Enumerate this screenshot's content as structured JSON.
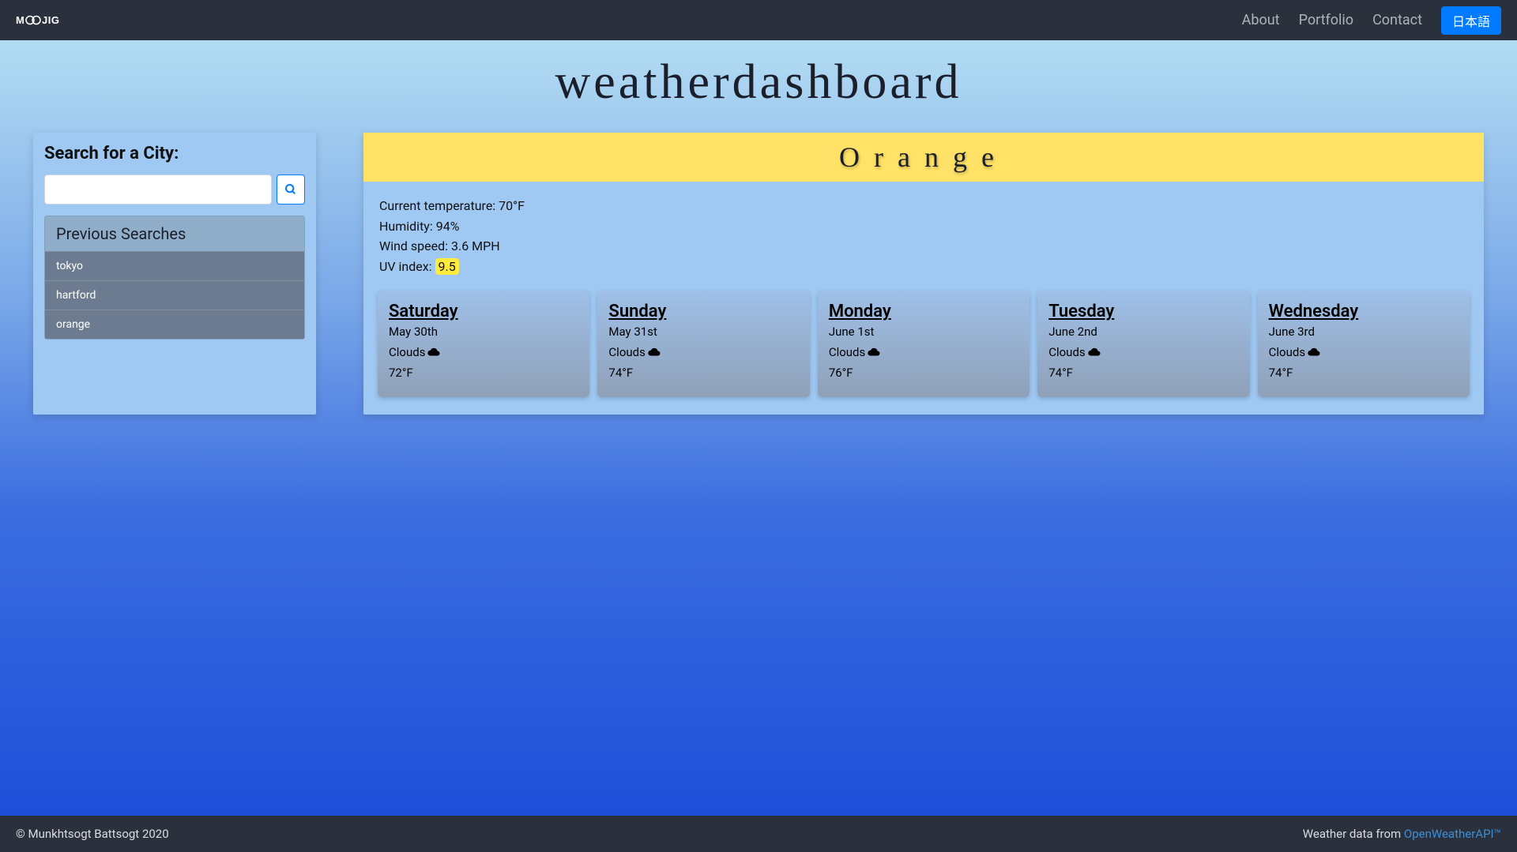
{
  "nav": {
    "links": [
      "About",
      "Portfolio",
      "Contact"
    ],
    "lang_btn": "日本語"
  },
  "hero": {
    "title": "weatherdashboard"
  },
  "sidebar": {
    "search_label": "Search for a City:",
    "search_placeholder": "",
    "previous_label": "Previous Searches",
    "history": [
      "tokyo",
      "hartford",
      "orange"
    ]
  },
  "weather": {
    "city": "Orange",
    "current": {
      "temp_label": "Current temperature: ",
      "temp_value": "70°F",
      "humidity_label": "Humidity: ",
      "humidity_value": "94%",
      "wind_label": "Wind speed: ",
      "wind_value": "3.6 MPH",
      "uv_label": "UV index: ",
      "uv_value": "9.5"
    },
    "forecast": [
      {
        "day": "Saturday",
        "date": "May 30th",
        "cond": "Clouds",
        "temp": "72°F"
      },
      {
        "day": "Sunday",
        "date": "May 31st",
        "cond": "Clouds",
        "temp": "74°F"
      },
      {
        "day": "Monday",
        "date": "June 1st",
        "cond": "Clouds",
        "temp": "76°F"
      },
      {
        "day": "Tuesday",
        "date": "June 2nd",
        "cond": "Clouds",
        "temp": "74°F"
      },
      {
        "day": "Wednesday",
        "date": "June 3rd",
        "cond": "Clouds",
        "temp": "74°F"
      }
    ]
  },
  "footer": {
    "copyright": "© Munkhtsogt Battsogt 2020",
    "credit_prefix": "Weather data from ",
    "credit_link": "OpenWeatherAPI™"
  }
}
